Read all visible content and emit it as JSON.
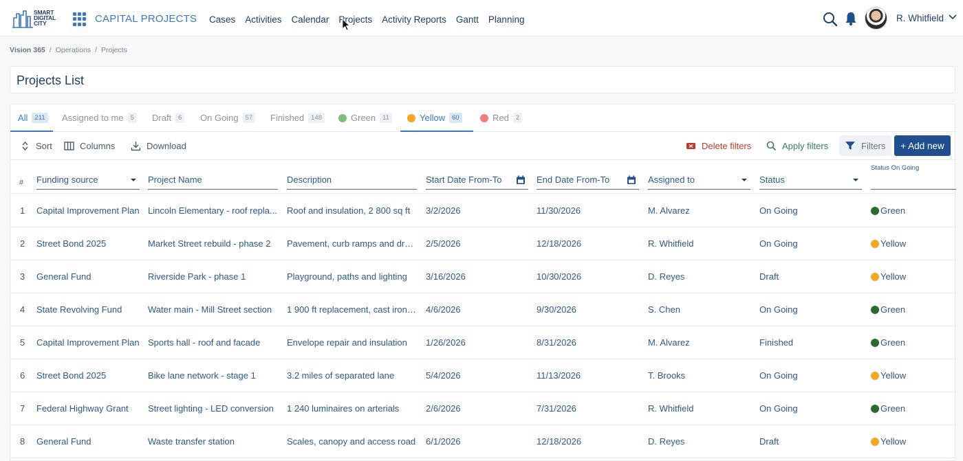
{
  "brand": {
    "logo_text": "SMART DIGITAL CITY",
    "logo_lines": [
      "SMART",
      "DIGITAL",
      "CITY"
    ],
    "app_title": "CAPITAL PROJECTS",
    "accent": "#3c78c2"
  },
  "nav": [
    "Cases",
    "Activities",
    "Calendar",
    "Projects",
    "Activity Reports",
    "Gantt",
    "Planning"
  ],
  "user": {
    "name": "R. Whitfield"
  },
  "breadcrumb": [
    "Vision 365",
    "Operations",
    "Projects"
  ],
  "page_title": "Projects List",
  "tabs": [
    {
      "label": "All",
      "count": "211",
      "active": true
    },
    {
      "label": "Assigned to me",
      "count": "5"
    },
    {
      "label": "Draft",
      "count": "6"
    },
    {
      "label": "On Going",
      "count": "57"
    },
    {
      "label": "Finished",
      "count": "148"
    },
    {
      "label": "Green",
      "count": "11",
      "dot": "#7fbf7a"
    },
    {
      "label": "Yellow",
      "count": "60",
      "dot": "#f5a623",
      "active": true
    },
    {
      "label": "Red",
      "count": "2",
      "dot": "#f08080"
    }
  ],
  "toolbar": {
    "sort": "Sort",
    "columns": "Columns",
    "download": "Download",
    "delete_filters": "Delete filters",
    "apply_filters": "Apply filters",
    "filters": "Filters",
    "add_new": "+ Add new"
  },
  "columns": {
    "hash": "#",
    "funding": "Funding source",
    "project": "Project Name",
    "description": "Description",
    "start": "Start Date From-To",
    "end": "End Date From-To",
    "assigned": "Assigned to",
    "status": "Status",
    "status_on_going": "Status On Going"
  },
  "flag_colors": {
    "Green": "#2e6b2e",
    "Yellow": "#f5a623"
  },
  "rows": [
    {
      "n": "1",
      "funding": "Capital Improvement Plan",
      "project": "Lincoln Elementary - roof repla...",
      "description": "Roof and insulation, 2 800 sq ft",
      "start": "3/2/2026",
      "end": "11/30/2026",
      "assigned": "M. Alvarez",
      "status": "On Going",
      "flag": "Green"
    },
    {
      "n": "2",
      "funding": "Street Bond 2025",
      "project": "Market Street rebuild - phase 2",
      "description": "Pavement, curb ramps and drai...",
      "start": "2/5/2026",
      "end": "12/18/2026",
      "assigned": "R. Whitfield",
      "status": "On Going",
      "flag": "Yellow"
    },
    {
      "n": "3",
      "funding": "General Fund",
      "project": "Riverside Park - phase 1",
      "description": "Playground, paths and lighting",
      "start": "3/16/2026",
      "end": "10/30/2026",
      "assigned": "D. Reyes",
      "status": "Draft",
      "flag": "Yellow"
    },
    {
      "n": "4",
      "funding": "State Revolving Fund",
      "project": "Water main - Mill Street section",
      "description": "1 900 ft replacement, cast iron ...",
      "start": "4/6/2026",
      "end": "9/30/2026",
      "assigned": "S. Chen",
      "status": "On Going",
      "flag": "Green"
    },
    {
      "n": "5",
      "funding": "Capital Improvement Plan",
      "project": "Sports hall - roof and facade",
      "description": "Envelope repair and insulation",
      "start": "1/26/2026",
      "end": "8/31/2026",
      "assigned": "M. Alvarez",
      "status": "Finished",
      "flag": "Green"
    },
    {
      "n": "6",
      "funding": "Street Bond 2025",
      "project": "Bike lane network - stage 1",
      "description": "3.2 miles of separated lane",
      "start": "5/4/2026",
      "end": "11/13/2026",
      "assigned": "T. Brooks",
      "status": "On Going",
      "flag": "Yellow"
    },
    {
      "n": "7",
      "funding": "Federal Highway Grant",
      "project": "Street lighting - LED conversion",
      "description": "1 240 luminaires on arterials",
      "start": "2/6/2026",
      "end": "7/31/2026",
      "assigned": "R. Whitfield",
      "status": "On Going",
      "flag": "Green"
    },
    {
      "n": "8",
      "funding": "General Fund",
      "project": "Waste transfer station",
      "description": "Scales, canopy and access road",
      "start": "6/1/2026",
      "end": "12/18/2026",
      "assigned": "D. Reyes",
      "status": "Draft",
      "flag": "Yellow"
    }
  ]
}
